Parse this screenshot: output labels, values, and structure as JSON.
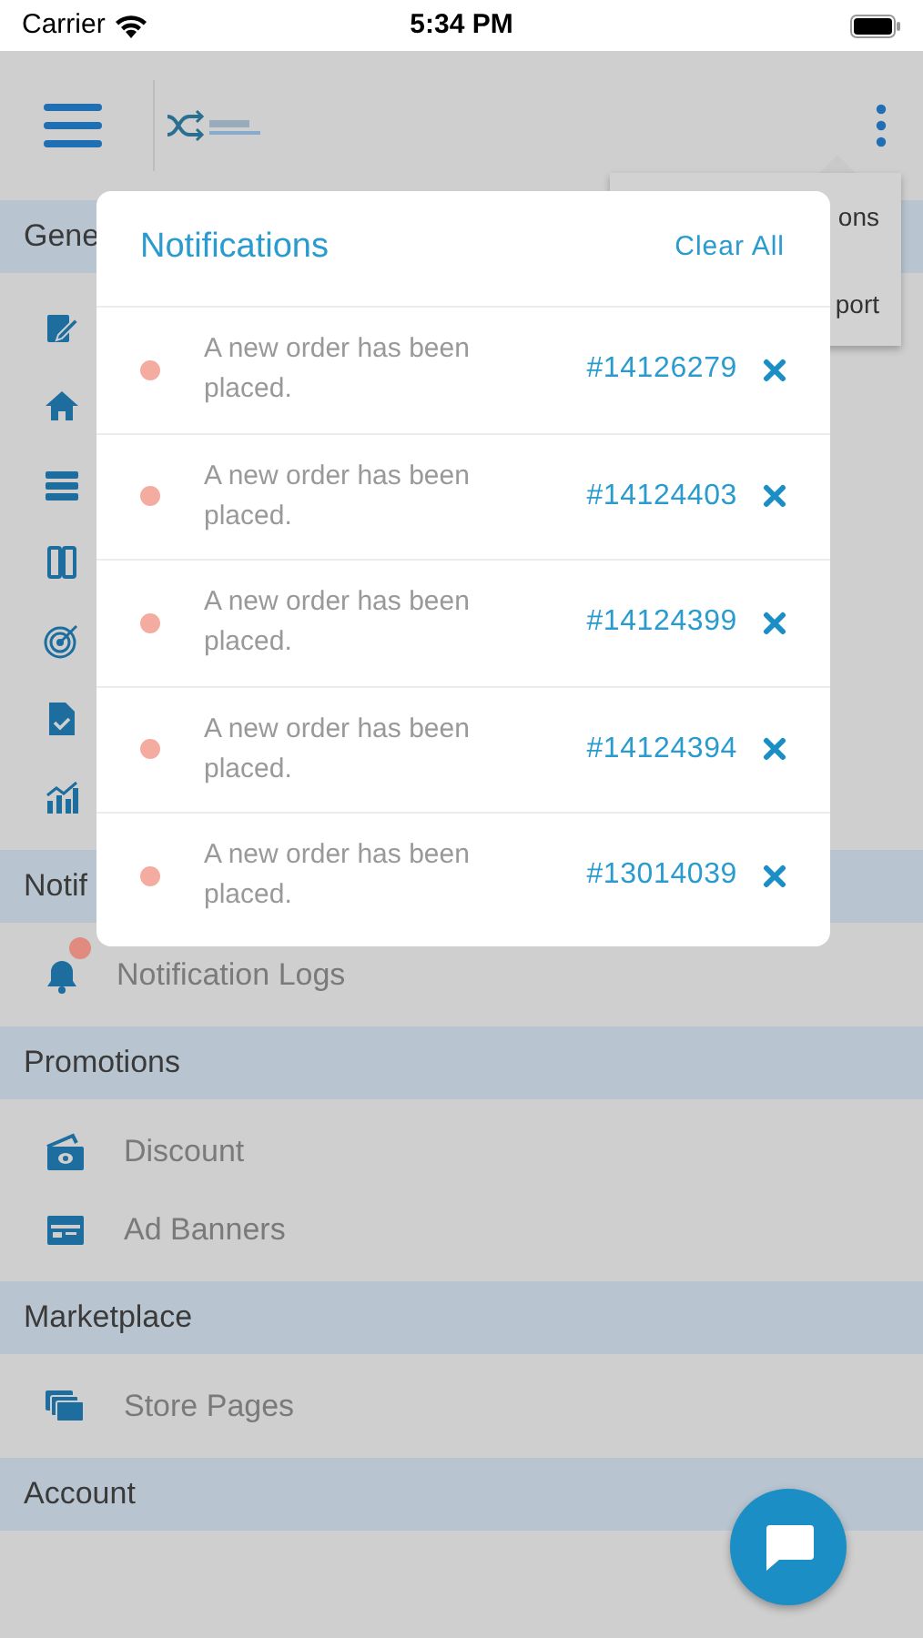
{
  "status_bar": {
    "carrier": "Carrier",
    "time": "5:34 PM"
  },
  "menu": {
    "items": [
      "ons",
      "port"
    ]
  },
  "sections": [
    {
      "title": "Gene"
    },
    {
      "title": "Notif",
      "items": [
        {
          "label": "Notification Logs"
        }
      ]
    },
    {
      "title": "Promotions",
      "items": [
        {
          "label": "Discount"
        },
        {
          "label": "Ad Banners"
        }
      ]
    },
    {
      "title": "Marketplace",
      "items": [
        {
          "label": "Store Pages"
        }
      ]
    },
    {
      "title": "Account"
    }
  ],
  "notifications_panel": {
    "title": "Notifications",
    "clear_all": "Clear All",
    "items": [
      {
        "message": "A new order has been placed.",
        "order": "#14126279",
        "unread": true
      },
      {
        "message": "A new order has been placed.",
        "order": "#14124403",
        "unread": true
      },
      {
        "message": "A new order has been placed.",
        "order": "#14124399",
        "unread": true
      },
      {
        "message": "A new order has been placed.",
        "order": "#14124394",
        "unread": true
      },
      {
        "message": "A new order has been placed.",
        "order": "#13014039",
        "unread": true
      }
    ]
  }
}
